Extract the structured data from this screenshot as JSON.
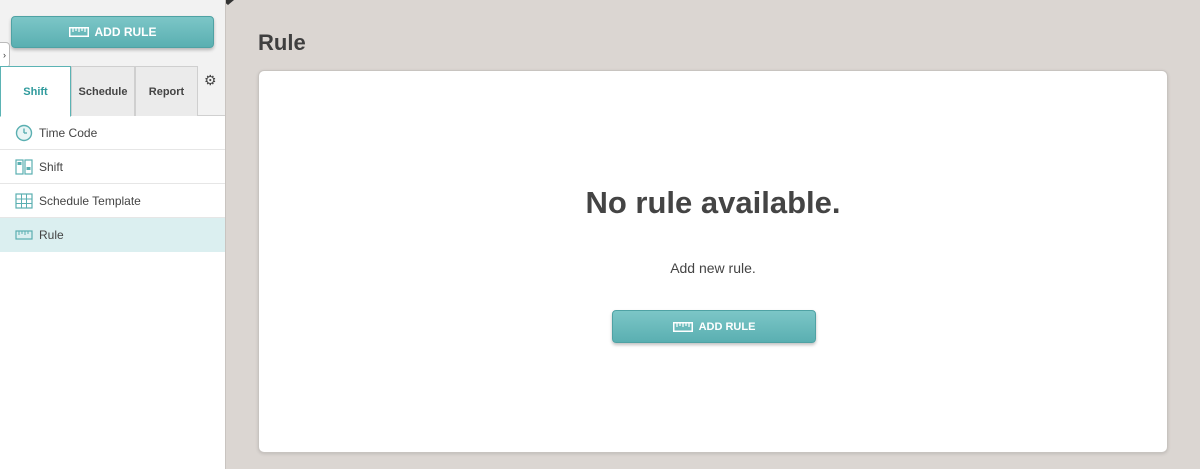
{
  "sidebar": {
    "add_button_label": "ADD RULE",
    "tabs": [
      {
        "label": "Shift",
        "active": true
      },
      {
        "label": "Schedule",
        "active": false
      },
      {
        "label": "Report",
        "active": false
      }
    ],
    "items": [
      {
        "label": "Time Code",
        "icon": "clock-icon"
      },
      {
        "label": "Shift",
        "icon": "shift-icon"
      },
      {
        "label": "Schedule Template",
        "icon": "schedule-template-icon"
      },
      {
        "label": "Rule",
        "icon": "ruler-icon",
        "selected": true
      }
    ]
  },
  "main": {
    "title": "Rule",
    "empty_title": "No rule available.",
    "empty_subtitle": "Add new rule.",
    "add_button_label": "ADD RULE"
  },
  "colors": {
    "accent": "#5aafb1",
    "selected_bg": "#dbeff0",
    "page_bg": "#dbd6d2"
  }
}
